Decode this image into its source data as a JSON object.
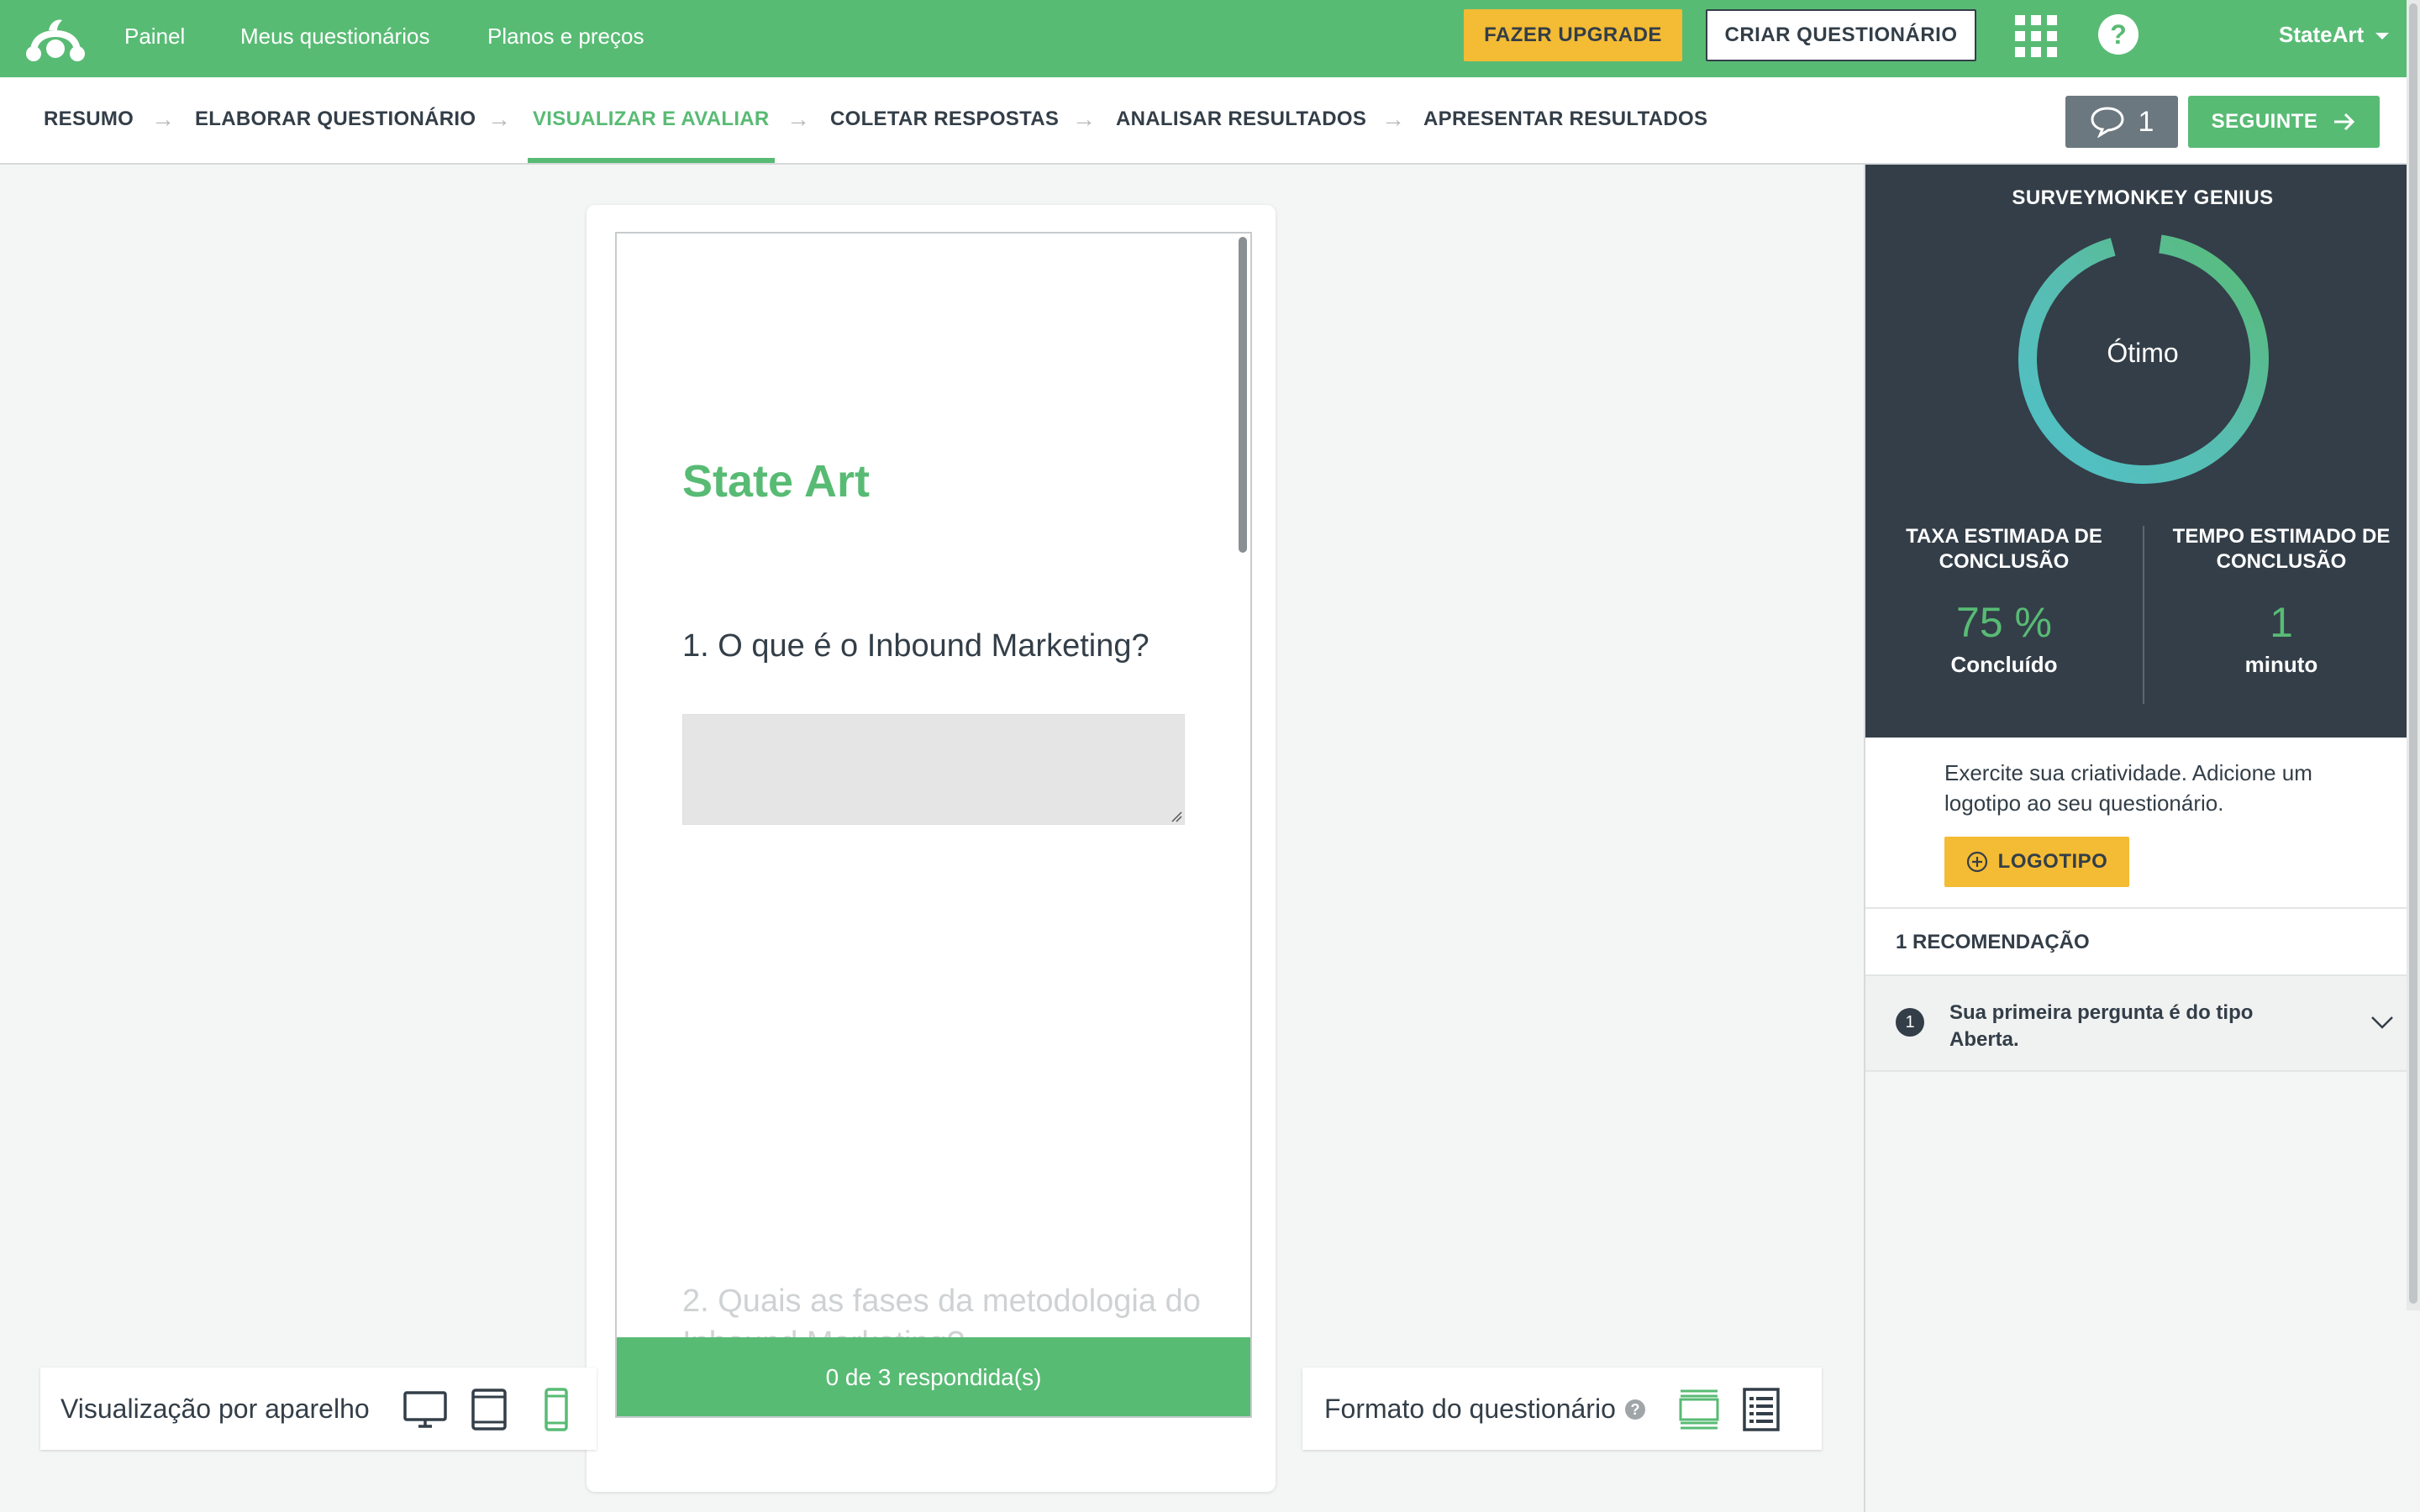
{
  "topnav": {
    "links": [
      "Painel",
      "Meus questionários",
      "Planos e preços"
    ],
    "upgrade_label": "FAZER UPGRADE",
    "create_label": "CRIAR QUESTIONÁRIO",
    "account_name": "StateArt",
    "brand_color": "#58bb74",
    "accent_color": "#f4bb34"
  },
  "steps": {
    "items": [
      "RESUMO",
      "ELABORAR QUESTIONÁRIO",
      "VISUALIZAR E AVALIAR",
      "COLETAR RESPOSTAS",
      "ANALISAR RESULTADOS",
      "APRESENTAR RESULTADOS"
    ],
    "active": "VISUALIZAR E AVALIAR",
    "comments_count": "1",
    "next_label": "SEGUINTE"
  },
  "preview": {
    "survey_title": "State Art",
    "question1": "1. O que é o Inbound Marketing?",
    "question2": "2. Quais as fases da metodologia do Inbound Marketing?",
    "progress_text": "0 de 3 respondida(s)"
  },
  "device_view": {
    "label": "Visualização por aparelho",
    "icons": [
      "desktop-icon",
      "tablet-icon",
      "mobile-icon"
    ],
    "selected": "mobile-icon"
  },
  "format": {
    "label": "Formato do questionário",
    "info": "?",
    "icons": [
      "one-question-at-a-time-icon",
      "classic-list-icon"
    ],
    "selected": "one-question-at-a-time-icon"
  },
  "genius": {
    "title": "SURVEYMONKEY GENIUS",
    "rating": "Ótimo",
    "completion_rate_title": "TAXA ESTIMADA DE CONCLUSÃO",
    "completion_rate_value": "75 %",
    "completion_rate_unit": "Concluído",
    "completion_time_title": "TEMPO ESTIMADO DE CONCLUSÃO",
    "completion_time_value": "1",
    "completion_time_unit": "minuto"
  },
  "logo_tip": {
    "text": "Exercite sua criatividade. Adicione um logotipo ao seu questionário.",
    "button_label": "LOGOTIPO"
  },
  "recommendations": {
    "header": "1 RECOMENDAÇÃO",
    "items": [
      {
        "number": "1",
        "text": "Sua primeira pergunta é do tipo Aberta."
      }
    ]
  }
}
